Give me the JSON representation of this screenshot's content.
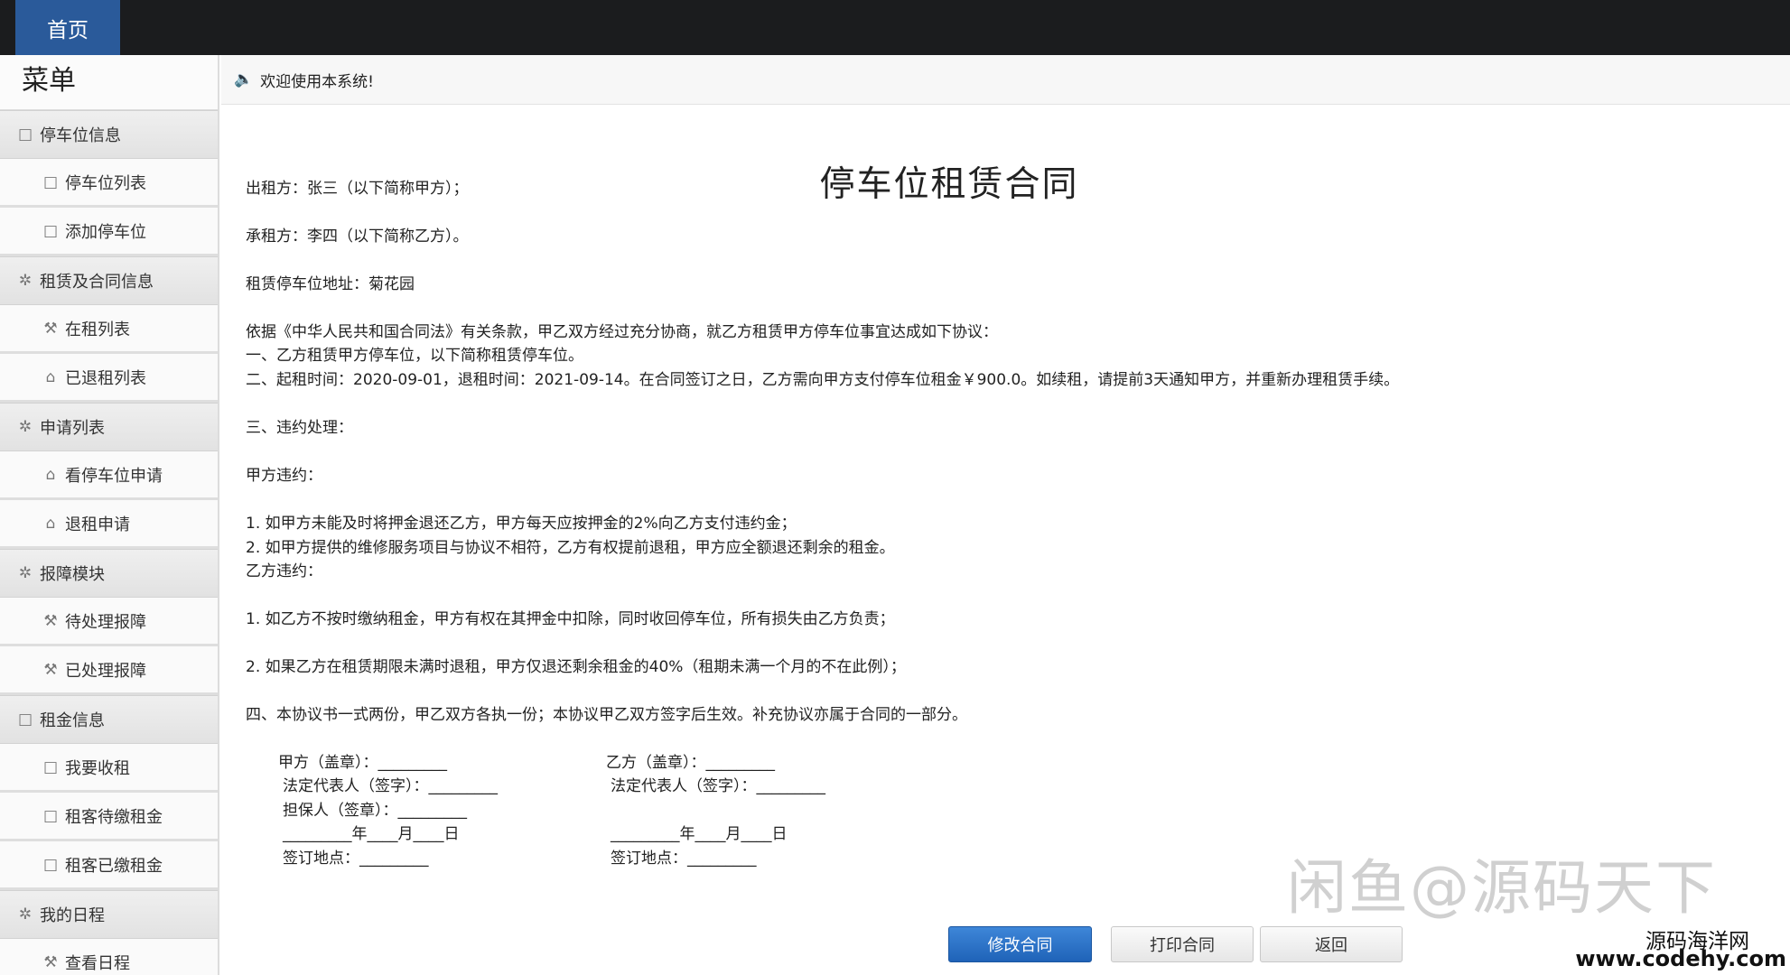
{
  "topbar": {
    "home_label": "首页"
  },
  "sidebar": {
    "title": "菜单",
    "entries": [
      {
        "type": "group",
        "icon": "□",
        "label": "停车位信息"
      },
      {
        "type": "item",
        "icon": "□",
        "label": "停车位列表"
      },
      {
        "type": "item",
        "icon": "□",
        "label": "添加停车位"
      },
      {
        "type": "group",
        "icon": "✲",
        "label": "租赁及合同信息"
      },
      {
        "type": "item",
        "icon": "⚒",
        "label": "在租列表"
      },
      {
        "type": "item",
        "icon": "⌂",
        "label": "已退租列表"
      },
      {
        "type": "group",
        "icon": "✲",
        "label": "申请列表"
      },
      {
        "type": "item",
        "icon": "⌂",
        "label": "看停车位申请"
      },
      {
        "type": "item",
        "icon": "⌂",
        "label": "退租申请"
      },
      {
        "type": "group",
        "icon": "✲",
        "label": "报障模块"
      },
      {
        "type": "item",
        "icon": "⚒",
        "label": "待处理报障"
      },
      {
        "type": "item",
        "icon": "⚒",
        "label": "已处理报障"
      },
      {
        "type": "group",
        "icon": "□",
        "label": "租金信息"
      },
      {
        "type": "item",
        "icon": "□",
        "label": "我要收租"
      },
      {
        "type": "item",
        "icon": "□",
        "label": "租客待缴租金"
      },
      {
        "type": "item",
        "icon": "□",
        "label": "租客已缴租金"
      },
      {
        "type": "group",
        "icon": "✲",
        "label": "我的日程"
      },
      {
        "type": "item",
        "icon": "⚒",
        "label": "查看日程"
      }
    ]
  },
  "welcome": {
    "text": "欢迎使用本系统!"
  },
  "contract": {
    "title": "停车位租赁合同",
    "lines": [
      "出租方：张三（以下简称甲方）；",
      "承租方：李四（以下简称乙方）。",
      "租赁停车位地址：菊花园",
      "依据《中华人民共和国合同法》有关条款，甲乙双方经过充分协商，就乙方租赁甲方停车位事宜达成如下协议：",
      "一、乙方租赁甲方停车位，以下简称租赁停车位。",
      "二、起租时间：2020-09-01，退租时间：2021-09-14。在合同签订之日，乙方需向甲方支付停车位租金￥900.0。如续租，请提前3天通知甲方，并重新办理租赁手续。",
      "三、违约处理：",
      "甲方违约：",
      "1.  如甲方未能及时将押金退还乙方，甲方每天应按押金的2%向乙方支付违约金；",
      "2.  如甲方提供的维修服务项目与协议不相符，乙方有权提前退租，甲方应全额退还剩余的租金。",
      "乙方违约：",
      "1.  如乙方不按时缴纳租金，甲方有权在其押金中扣除，同时收回停车位，所有损失由乙方负责；",
      "2.  如果乙方在租赁期限未满时退租，甲方仅退还剩余租金的40%（租期未满一个月的不在此例）；",
      "四、本协议书一式两份，甲乙双方各执一份；本协议甲乙双方签字后生效。补充协议亦属于合同的一部分。"
    ],
    "sign_left": [
      "甲方（盖章）：_________",
      "法定代表人（签字）：_________",
      "担保人（签章）：_________",
      "_________年____月____日",
      "签订地点：_________"
    ],
    "sign_right": [
      "乙方（盖章）：_________",
      "法定代表人（签字）：_________",
      "_________年____月____日",
      "签订地点：_________"
    ]
  },
  "buttons": {
    "edit": "修改合同",
    "print": "打印合同",
    "back": "返回"
  },
  "watermark": "闲鱼@源码天下",
  "corner": {
    "logo": "源码海洋网",
    "url": "www.codehy.com"
  }
}
